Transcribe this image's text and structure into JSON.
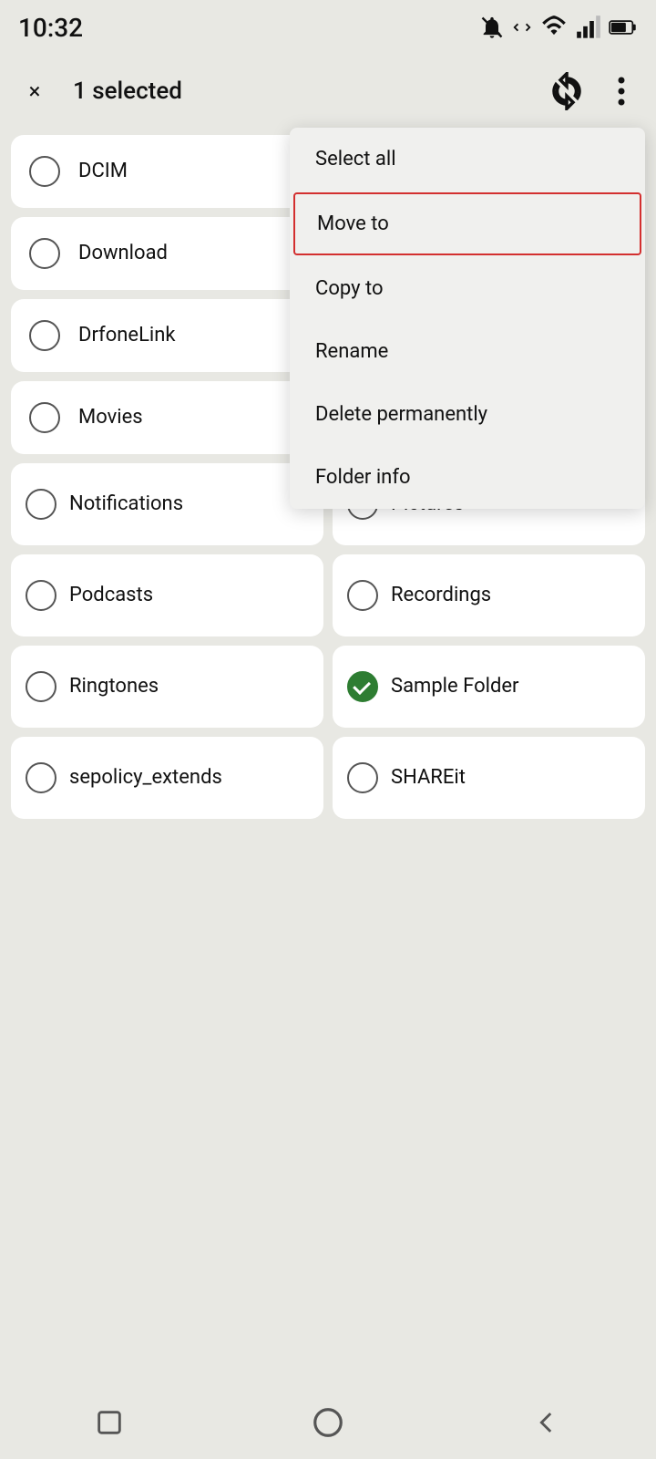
{
  "status": {
    "time": "10:32"
  },
  "appBar": {
    "title": "1 selected",
    "close_label": "×"
  },
  "contextMenu": {
    "items": [
      {
        "id": "select-all",
        "label": "Select all",
        "highlighted": false
      },
      {
        "id": "move-to",
        "label": "Move to",
        "highlighted": true
      },
      {
        "id": "copy-to",
        "label": "Copy to",
        "highlighted": false
      },
      {
        "id": "rename",
        "label": "Rename",
        "highlighted": false
      },
      {
        "id": "delete-permanently",
        "label": "Delete permanently",
        "highlighted": false
      },
      {
        "id": "folder-info",
        "label": "Folder info",
        "highlighted": false
      }
    ]
  },
  "folders": [
    {
      "id": "dcim",
      "label": "DCIM",
      "fullWidth": true,
      "checked": false
    },
    {
      "id": "download",
      "label": "Download",
      "fullWidth": true,
      "checked": false
    },
    {
      "id": "drfonelink",
      "label": "DrfoneLink",
      "fullWidth": true,
      "checked": false
    },
    {
      "id": "movies",
      "label": "Movies",
      "fullWidth": true,
      "checked": false
    },
    {
      "id": "notifications",
      "label": "Notifications",
      "fullWidth": false,
      "checked": false
    },
    {
      "id": "pictures",
      "label": "Pictures",
      "fullWidth": false,
      "checked": false
    },
    {
      "id": "podcasts",
      "label": "Podcasts",
      "fullWidth": false,
      "checked": false
    },
    {
      "id": "recordings",
      "label": "Recordings",
      "fullWidth": false,
      "checked": false
    },
    {
      "id": "ringtones",
      "label": "Ringtones",
      "fullWidth": false,
      "checked": false
    },
    {
      "id": "sample-folder",
      "label": "Sample Folder",
      "fullWidth": false,
      "checked": true
    },
    {
      "id": "sepolicy-extends",
      "label": "sepolicy_extends",
      "fullWidth": false,
      "checked": false
    },
    {
      "id": "shareit",
      "label": "SHAREit",
      "fullWidth": false,
      "checked": false
    }
  ],
  "nav": {
    "square_label": "□",
    "circle_label": "○",
    "back_label": "◁"
  }
}
